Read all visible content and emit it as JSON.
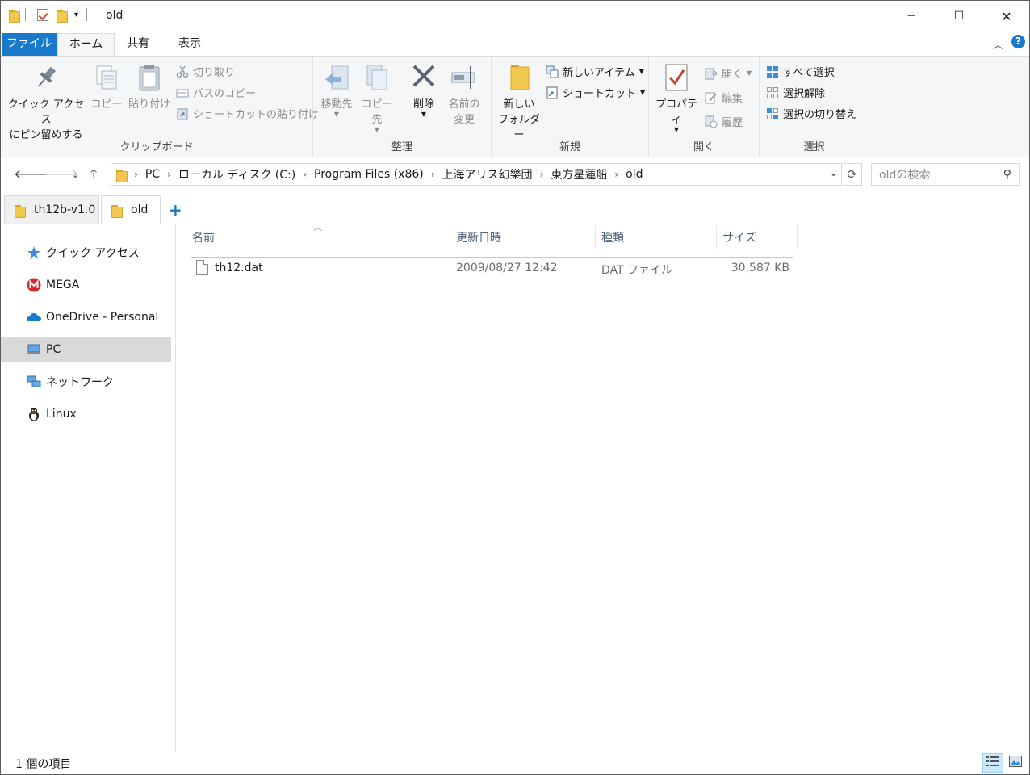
{
  "window": {
    "title": "old",
    "controls": {
      "minimize": "─",
      "maximize": "☐",
      "close": "✕"
    }
  },
  "ribbon_tabs": {
    "file": "ファイル",
    "home": "ホーム",
    "share": "共有",
    "view": "表示"
  },
  "ribbon": {
    "clipboard": {
      "label": "クリップボード",
      "pin_line1": "クイック アクセス",
      "pin_line2": "にピン留めする",
      "copy": "コピー",
      "paste": "貼り付け",
      "cut": "切り取り",
      "copy_path": "パスのコピー",
      "paste_shortcut": "ショートカットの貼り付け"
    },
    "organize": {
      "label": "整理",
      "move_to": "移動先",
      "copy_to": "コピー先",
      "delete": "削除",
      "rename_line1": "名前の",
      "rename_line2": "変更"
    },
    "new": {
      "label": "新規",
      "new_folder_line1": "新しい",
      "new_folder_line2": "フォルダー",
      "new_item": "新しいアイテム",
      "shortcut": "ショートカット"
    },
    "open": {
      "label": "開く",
      "properties": "プロパティ",
      "open": "開く",
      "edit": "編集",
      "history": "履歴"
    },
    "select": {
      "label": "選択",
      "select_all": "すべて選択",
      "select_none": "選択解除",
      "invert": "選択の切り替え"
    }
  },
  "address": {
    "crumbs": [
      "PC",
      "ローカル ディスク (C:)",
      "Program Files (x86)",
      "上海アリス幻樂団",
      "東方星蓮船",
      "old"
    ]
  },
  "search": {
    "placeholder": "oldの検索"
  },
  "doc_tabs": [
    "th12b-v1.0",
    "old"
  ],
  "nav": [
    {
      "label": "クイック アクセス",
      "icon": "star-icon"
    },
    {
      "label": "MEGA",
      "icon": "mega-icon"
    },
    {
      "label": "OneDrive - Personal",
      "icon": "cloud-icon"
    },
    {
      "label": "PC",
      "icon": "pc-icon",
      "selected": true
    },
    {
      "label": "ネットワーク",
      "icon": "network-icon"
    },
    {
      "label": "Linux",
      "icon": "linux-icon"
    }
  ],
  "columns": {
    "name": "名前",
    "modified": "更新日時",
    "type": "種類",
    "size": "サイズ"
  },
  "files": [
    {
      "name": "th12.dat",
      "modified": "2009/08/27 12:42",
      "type": "DAT ファイル",
      "size": "30,587 KB"
    }
  ],
  "status": {
    "count": "1 個の項目"
  }
}
